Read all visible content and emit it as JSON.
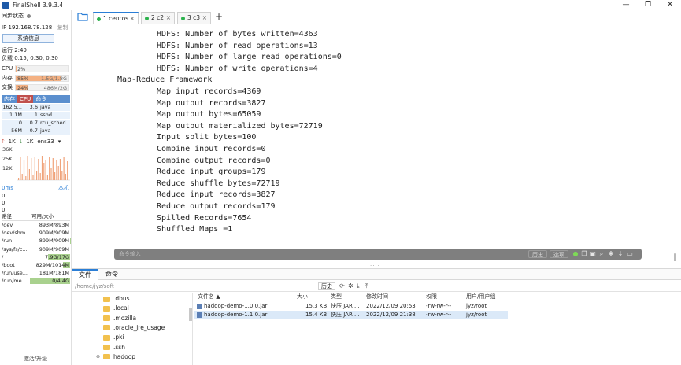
{
  "window": {
    "title": "FinalShell 3.9.3.4",
    "controls": {
      "minimize": "—",
      "maximize": "❐",
      "close": "✕"
    }
  },
  "sidebar": {
    "sync_status": "同步状态",
    "ip": "IP 192.168.78.128",
    "copy": "复制",
    "sysinfo_button": "系统信息",
    "uptime": "运行 2:49",
    "load": "负载 0.15, 0.30, 0.30",
    "cpu": {
      "label": "CPU",
      "value": "2%",
      "fraction": 0.02
    },
    "mem": {
      "label": "内存",
      "percent": "85%",
      "detail": "1.5G/1.8G",
      "fraction": 0.85
    },
    "swap": {
      "label": "交换",
      "percent": "24%",
      "detail": "486M/2G",
      "fraction": 0.24
    },
    "proc_tabs": [
      "内存",
      "CPU",
      "命令"
    ],
    "processes": [
      {
        "mem": "162.5...",
        "cpu": "3.6",
        "cmd": "java"
      },
      {
        "mem": "1.1M",
        "cpu": "1",
        "cmd": "sshd"
      },
      {
        "mem": "0",
        "cpu": "0.7",
        "cmd": "rcu_sched"
      },
      {
        "mem": "56M",
        "cpu": "0.7",
        "cmd": "java"
      }
    ],
    "net": {
      "up": "1K",
      "down": "1K",
      "iface": "ens33",
      "y_labels": [
        "36K",
        "25K",
        "12K"
      ]
    },
    "latency": {
      "value": "0ms",
      "target": "本机",
      "rows": [
        "0",
        "0",
        "0"
      ]
    },
    "disk_header": {
      "path": "路径",
      "size": "可用/大小"
    },
    "disks": [
      {
        "path": "/dev",
        "size": "893M/893M",
        "fraction": 0
      },
      {
        "path": "/dev/shm",
        "size": "909M/909M",
        "fraction": 0
      },
      {
        "path": "/run",
        "size": "899M/909M",
        "fraction": 0.01
      },
      {
        "path": "/sys/fs/c...",
        "size": "909M/909M",
        "fraction": 0
      },
      {
        "path": "/",
        "size": "7.9G/17G",
        "fraction": 0.54
      },
      {
        "path": "/boot",
        "size": "829M/1014M",
        "fraction": 0.18
      },
      {
        "path": "/run/use...",
        "size": "181M/181M",
        "fraction": 0
      },
      {
        "path": "/run/me...",
        "size": "0/4.4G",
        "fraction": 1.0
      }
    ],
    "upgrade": "激活/升级"
  },
  "tabs": [
    {
      "label": "1 centos",
      "active": true
    },
    {
      "label": "2 c2",
      "active": false
    },
    {
      "label": "3 c3",
      "active": false
    }
  ],
  "terminal": {
    "lines": [
      {
        "indent": 2,
        "text": "HDFS: Number of bytes written=4363"
      },
      {
        "indent": 2,
        "text": "HDFS: Number of read operations=13"
      },
      {
        "indent": 2,
        "text": "HDFS: Number of large read operations=0"
      },
      {
        "indent": 2,
        "text": "HDFS: Number of write operations=4"
      },
      {
        "indent": 1,
        "text": "Map-Reduce Framework"
      },
      {
        "indent": 2,
        "text": "Map input records=4369"
      },
      {
        "indent": 2,
        "text": "Map output records=3827"
      },
      {
        "indent": 2,
        "text": "Map output bytes=65059"
      },
      {
        "indent": 2,
        "text": "Map output materialized bytes=72719"
      },
      {
        "indent": 2,
        "text": "Input split bytes=100"
      },
      {
        "indent": 2,
        "text": "Combine input records=0"
      },
      {
        "indent": 2,
        "text": "Combine output records=0"
      },
      {
        "indent": 2,
        "text": "Reduce input groups=179"
      },
      {
        "indent": 2,
        "text": "Reduce shuffle bytes=72719"
      },
      {
        "indent": 2,
        "text": "Reduce input records=3827"
      },
      {
        "indent": 2,
        "text": "Reduce output records=179"
      },
      {
        "indent": 2,
        "text": "Spilled Records=7654"
      },
      {
        "indent": 2,
        "text": "Shuffled Maps =1"
      }
    ]
  },
  "command_bar": {
    "placeholder": "命令输入",
    "history": "历史",
    "options": "选项"
  },
  "bottom_tabs": [
    "文件",
    "命令"
  ],
  "file_browser": {
    "path": "/home/jyz/soft",
    "history_button": "历史",
    "tree": [
      {
        "name": ".dbus",
        "expandable": false
      },
      {
        "name": ".local",
        "expandable": false
      },
      {
        "name": ".mozilla",
        "expandable": false
      },
      {
        "name": ".oracle_jre_usage",
        "expandable": false
      },
      {
        "name": ".pki",
        "expandable": false
      },
      {
        "name": ".ssh",
        "expandable": false
      },
      {
        "name": "hadoop",
        "expandable": true
      }
    ],
    "columns": {
      "name": "文件名 ▲",
      "size": "大小",
      "type": "类型",
      "mtime": "修改时间",
      "perm": "权限",
      "owner": "用户/用户组"
    },
    "files": [
      {
        "name": "hadoop-demo-1.0.0.jar",
        "size": "15.3 KB",
        "type": "快压 JAR ...",
        "mtime": "2022/12/09 20:53",
        "perm": "-rw-rw-r--",
        "owner": "jyz/root",
        "selected": false
      },
      {
        "name": "hadoop-demo-1.1.0.jar",
        "size": "15.4 KB",
        "type": "快压 JAR ...",
        "mtime": "2022/12/09 21:38",
        "perm": "-rw-rw-r--",
        "owner": "jyz/root",
        "selected": true
      }
    ]
  },
  "colors": {
    "accent": "#2a7ed6",
    "meter_fill": "#f4b183",
    "proc_tab_bg": "#5b8fce",
    "proc_tab_active": "#c0504d",
    "net_bar": "#f0a37a",
    "disk_fill": "#a9d18e",
    "cmdbar_bg": "#7f7f7f"
  }
}
